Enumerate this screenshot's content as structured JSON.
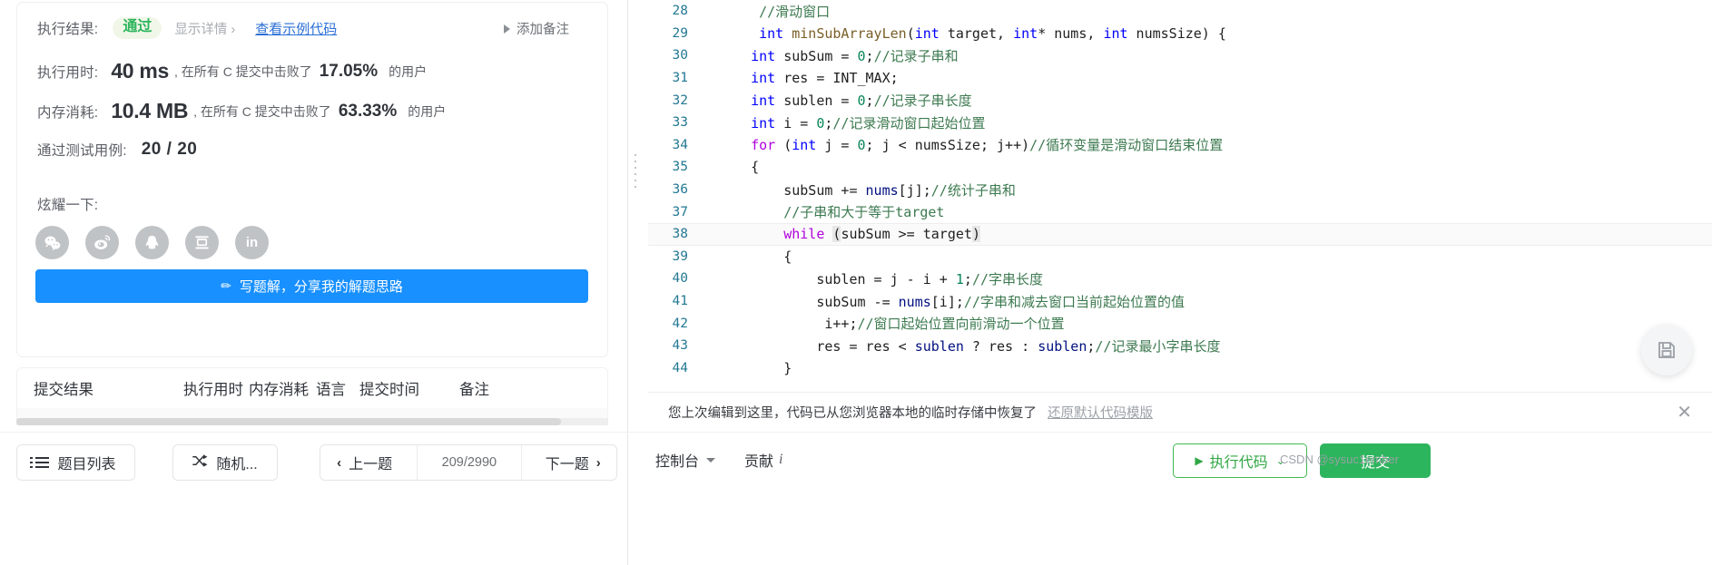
{
  "colors": {
    "accent_blue": "#1890ff",
    "success_green": "#2db55d",
    "run_green": "#31a745",
    "link_blue": "#2b6fd6",
    "pill_bg": "#f1f7e8"
  },
  "result": {
    "result_label": "执行结果:",
    "status": "通过",
    "detail_link": "显示详情 ›",
    "sample_code_link": "查看示例代码",
    "add_note": "添加备注",
    "runtime_label": "执行用时:",
    "runtime_value": "40 ms",
    "runtime_prefix": ", 在所有 C 提交中击败了",
    "runtime_percent": "17.05%",
    "runtime_suffix": "的用户",
    "memory_label": "内存消耗:",
    "memory_value": "10.4 MB",
    "memory_prefix": ", 在所有 C 提交中击败了",
    "memory_percent": "63.33%",
    "memory_suffix": "的用户",
    "cases_label": "通过测试用例:",
    "cases_value": "20 / 20",
    "brag_label": "炫耀一下:",
    "share_icons": [
      "wechat-icon",
      "weibo-icon",
      "qq-icon",
      "douban-icon",
      "linkedin-icon"
    ],
    "write_solution_button": "写题解，分享我的解题思路"
  },
  "submissions_table": {
    "columns": [
      "提交结果",
      "执行用时",
      "内存消耗",
      "语言",
      "提交时间",
      "备注"
    ]
  },
  "left_toolbar": {
    "problem_list": "题目列表",
    "random": "随机...",
    "prev": "上一题",
    "counter": "209/2990",
    "next": "下一题"
  },
  "editor": {
    "lines": [
      {
        "no": "28",
        "active": false,
        "tokens": [
          {
            "t": "    ",
            "c": ""
          },
          {
            "t": "//滑动窗口",
            "c": "cmt"
          }
        ]
      },
      {
        "no": "29",
        "active": false,
        "tokens": [
          {
            "t": "    ",
            "c": ""
          },
          {
            "t": "int",
            "c": "kw"
          },
          {
            "t": " ",
            "c": ""
          },
          {
            "t": "minSubArrayLen",
            "c": "fn"
          },
          {
            "t": "(",
            "c": ""
          },
          {
            "t": "int",
            "c": "kw"
          },
          {
            "t": " target, ",
            "c": ""
          },
          {
            "t": "int",
            "c": "kw"
          },
          {
            "t": "* nums, ",
            "c": ""
          },
          {
            "t": "int",
            "c": "kw"
          },
          {
            "t": " numsSize) {",
            "c": ""
          }
        ]
      },
      {
        "no": "30",
        "active": false,
        "tokens": [
          {
            "t": "   ",
            "c": ""
          },
          {
            "t": "int",
            "c": "kw"
          },
          {
            "t": " subSum = ",
            "c": ""
          },
          {
            "t": "0",
            "c": "num"
          },
          {
            "t": ";",
            "c": ""
          },
          {
            "t": "//记录子串和",
            "c": "cmt"
          }
        ]
      },
      {
        "no": "31",
        "active": false,
        "tokens": [
          {
            "t": "   ",
            "c": ""
          },
          {
            "t": "int",
            "c": "kw"
          },
          {
            "t": " res = INT_MAX;",
            "c": ""
          }
        ]
      },
      {
        "no": "32",
        "active": false,
        "tokens": [
          {
            "t": "   ",
            "c": ""
          },
          {
            "t": "int",
            "c": "kw"
          },
          {
            "t": " sublen = ",
            "c": ""
          },
          {
            "t": "0",
            "c": "num"
          },
          {
            "t": ";",
            "c": ""
          },
          {
            "t": "//记录子串长度",
            "c": "cmt"
          }
        ]
      },
      {
        "no": "33",
        "active": false,
        "tokens": [
          {
            "t": "   ",
            "c": ""
          },
          {
            "t": "int",
            "c": "kw"
          },
          {
            "t": " i = ",
            "c": ""
          },
          {
            "t": "0",
            "c": "num"
          },
          {
            "t": ";",
            "c": ""
          },
          {
            "t": "//记录滑动窗口起始位置",
            "c": "cmt"
          }
        ]
      },
      {
        "no": "34",
        "active": false,
        "tokens": [
          {
            "t": "   ",
            "c": ""
          },
          {
            "t": "for",
            "c": "kw2"
          },
          {
            "t": " (",
            "c": ""
          },
          {
            "t": "int",
            "c": "kw"
          },
          {
            "t": " j = ",
            "c": ""
          },
          {
            "t": "0",
            "c": "num"
          },
          {
            "t": "; j < numsSize; j++)",
            "c": ""
          },
          {
            "t": "//循环变量是滑动窗口结束位置",
            "c": "cmt"
          }
        ]
      },
      {
        "no": "35",
        "active": false,
        "tokens": [
          {
            "t": "   {",
            "c": ""
          }
        ]
      },
      {
        "no": "36",
        "active": false,
        "tokens": [
          {
            "t": "       subSum += ",
            "c": ""
          },
          {
            "t": "nums",
            "c": "var"
          },
          {
            "t": "[j];",
            "c": ""
          },
          {
            "t": "//统计子串和",
            "c": "cmt"
          }
        ]
      },
      {
        "no": "37",
        "active": false,
        "tokens": [
          {
            "t": "       ",
            "c": ""
          },
          {
            "t": "//子串和大于等于target",
            "c": "cmt"
          }
        ]
      },
      {
        "no": "38",
        "active": true,
        "tokens": [
          {
            "t": "       ",
            "c": ""
          },
          {
            "t": "while",
            "c": "kw2"
          },
          {
            "t": " ",
            "c": ""
          },
          {
            "t": "(",
            "c": "brkt"
          },
          {
            "t": "subSum >= target",
            "c": ""
          },
          {
            "t": ")",
            "c": "brkt"
          }
        ]
      },
      {
        "no": "39",
        "active": false,
        "tokens": [
          {
            "t": "       {",
            "c": ""
          }
        ]
      },
      {
        "no": "40",
        "active": false,
        "tokens": [
          {
            "t": "           sublen = j - i + ",
            "c": ""
          },
          {
            "t": "1",
            "c": "num"
          },
          {
            "t": ";",
            "c": ""
          },
          {
            "t": "//字串长度",
            "c": "cmt"
          }
        ]
      },
      {
        "no": "41",
        "active": false,
        "tokens": [
          {
            "t": "           subSum -= ",
            "c": ""
          },
          {
            "t": "nums",
            "c": "var"
          },
          {
            "t": "[i];",
            "c": ""
          },
          {
            "t": "//字串和减去窗口当前起始位置的值",
            "c": "cmt"
          }
        ]
      },
      {
        "no": "42",
        "active": false,
        "tokens": [
          {
            "t": "            i++;",
            "c": ""
          },
          {
            "t": "//窗口起始位置向前滑动一个位置",
            "c": "cmt"
          }
        ]
      },
      {
        "no": "43",
        "active": false,
        "tokens": [
          {
            "t": "           res = res < ",
            "c": ""
          },
          {
            "t": "sublen",
            "c": "var"
          },
          {
            "t": " ? res : ",
            "c": ""
          },
          {
            "t": "sublen",
            "c": "var"
          },
          {
            "t": ";",
            "c": ""
          },
          {
            "t": "//记录最小字串长度",
            "c": "cmt"
          }
        ]
      },
      {
        "no": "44",
        "active": false,
        "tokens": [
          {
            "t": "       }",
            "c": ""
          }
        ]
      }
    ]
  },
  "notice": {
    "text": "您上次编辑到这里，代码已从您浏览器本地的临时存储中恢复了",
    "restore_link": "还原默认代码模版",
    "close_icon": "close-icon"
  },
  "editor_bottom": {
    "console": "控制台",
    "contribute": "贡献",
    "contribute_icon": "info-icon",
    "run": "执行代码",
    "submit": "提交"
  },
  "watermark": "CSDN @sysuc1ember"
}
